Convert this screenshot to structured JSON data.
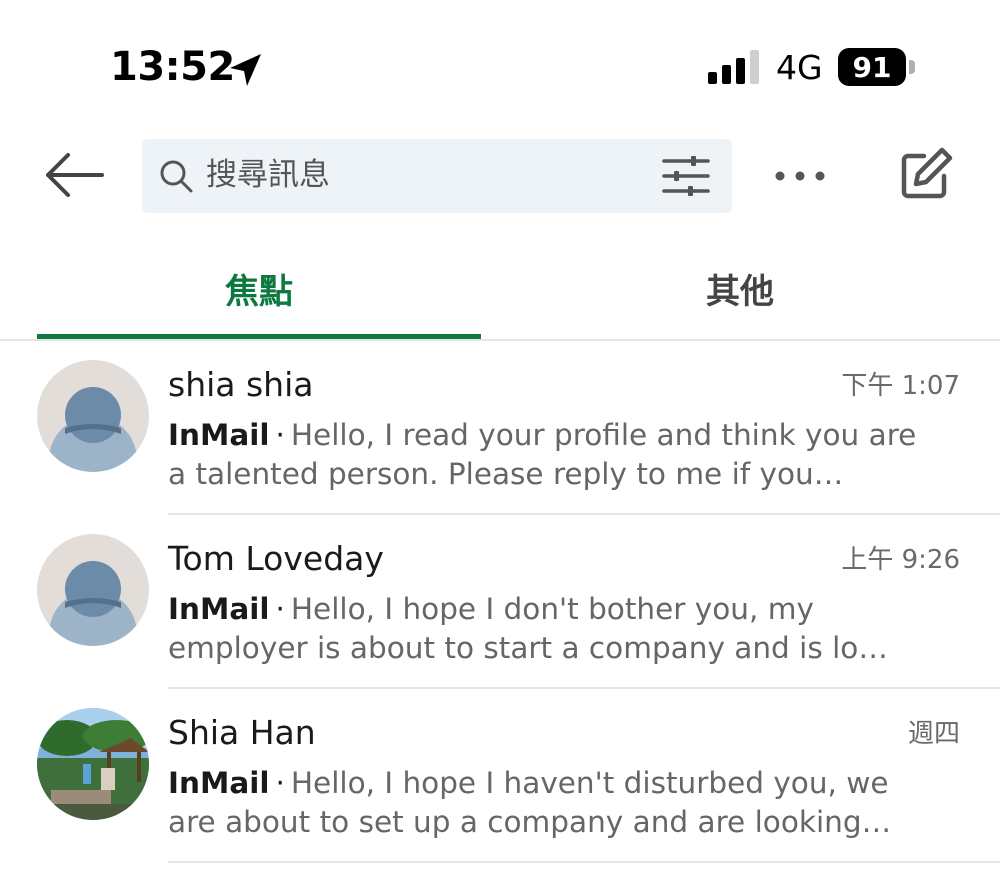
{
  "status_bar": {
    "time": "13:52",
    "network": "4G",
    "battery": "91"
  },
  "header": {
    "search_placeholder": "搜尋訊息"
  },
  "tabs": [
    {
      "label": "焦點",
      "active": true
    },
    {
      "label": "其他",
      "active": false
    }
  ],
  "conversations": [
    {
      "name": "shia shia",
      "time": "下午 1:07",
      "prefix": "InMail",
      "separator": "·",
      "preview": "Hello, I read your profile and think you are a talented person. Please reply to me if you…",
      "avatar": "default-avatar"
    },
    {
      "name": "Tom Loveday",
      "time": "上午 9:26",
      "prefix": "InMail",
      "separator": "·",
      "preview": "Hello, I hope I don't bother you, my employer is about to start a company and is lo…",
      "avatar": "default-avatar"
    },
    {
      "name": "Shia Han",
      "time": "週四",
      "prefix": "InMail",
      "separator": "·",
      "preview": "Hello, I hope I haven't disturbed you, we are about to set up a company and are looking…",
      "avatar": "photo-avatar"
    }
  ],
  "colors": {
    "accent": "#0c7a3e",
    "search_bg": "#eef3f8"
  }
}
